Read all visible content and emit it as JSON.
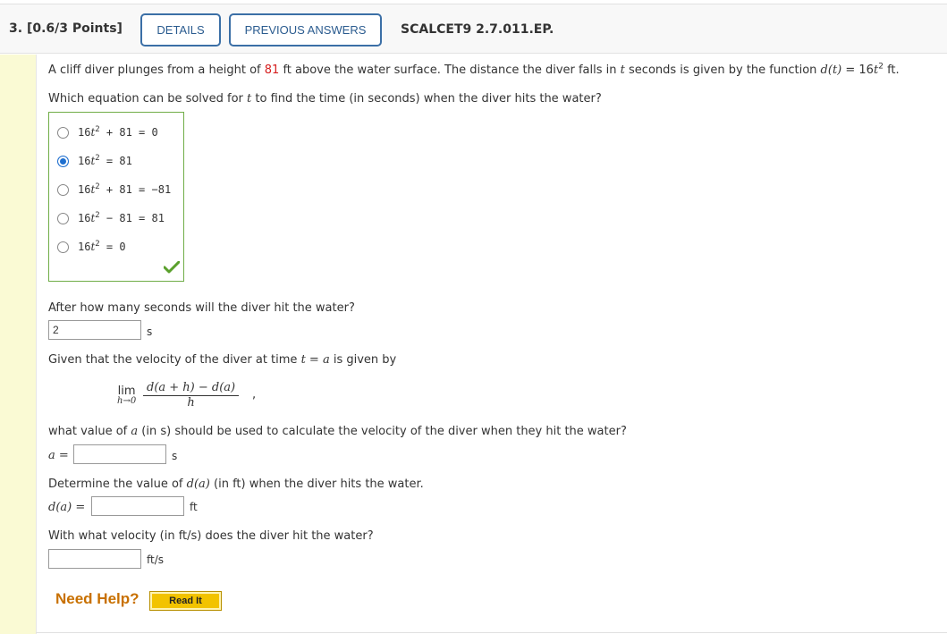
{
  "header": {
    "question_number": "3.",
    "points": "[0.6/3 Points]",
    "details_button": "DETAILS",
    "previous_answers_button": "PREVIOUS ANSWERS",
    "code": "SCALCET9 2.7.011.EP."
  },
  "problem": {
    "intro_part1": "A cliff diver plunges from a height of",
    "height_value": "81",
    "intro_part2": "ft above the water surface. The distance the diver falls in",
    "var_t": "t",
    "intro_part3": "seconds is given by the function",
    "func_lhs": "d(t)",
    "func_rhs_coef": "= 16",
    "func_rhs_var": "t",
    "func_rhs_exp": "2",
    "func_unit": "ft."
  },
  "q1": {
    "prompt_part1": "Which equation can be solved for",
    "prompt_var": "t",
    "prompt_part2": "to find the time (in seconds) when the diver hits the water?",
    "options": [
      {
        "coef": "16",
        "var": "t",
        "exp": "2",
        "rest": " + 81 = 0",
        "selected": false
      },
      {
        "coef": "16",
        "var": "t",
        "exp": "2",
        "rest": " = 81",
        "selected": true
      },
      {
        "coef": "16",
        "var": "t",
        "exp": "2",
        "rest": " + 81 = −81",
        "selected": false
      },
      {
        "coef": "16",
        "var": "t",
        "exp": "2",
        "rest": " − 81 = 81",
        "selected": false
      },
      {
        "coef": "16",
        "var": "t",
        "exp": "2",
        "rest": " = 0",
        "selected": false
      }
    ]
  },
  "q2": {
    "prompt": "After how many seconds will the diver hit the water?",
    "value": "2",
    "unit": "s"
  },
  "q3": {
    "given_part1": "Given that the velocity of the diver at time",
    "given_eq": "t = a",
    "given_part2": "is given by",
    "lim": "lim",
    "lim_sub": "h→0",
    "numerator": "d(a + h) − d(a)",
    "denominator": "h",
    "comma": ",",
    "prompt_part1": "what value of",
    "prompt_var": "a",
    "prompt_part2": "(in s) should be used to calculate the velocity of the diver when they hit the water?",
    "label": "a =",
    "value": "",
    "unit": "s"
  },
  "q4": {
    "prompt_part1": "Determine the value of",
    "prompt_expr": "d(a)",
    "prompt_part2": "(in ft) when the diver hits the water.",
    "label": "d(a) =",
    "value": "",
    "unit": "ft"
  },
  "q5": {
    "prompt": "With what velocity (in ft/s) does the diver hit the water?",
    "value": "",
    "unit": "ft/s"
  },
  "help": {
    "need_help": "Need Help?",
    "read_it": "Read It"
  },
  "colors": {
    "accent_blue": "#2a5b8f",
    "correct_green": "#70ad47",
    "highlight_red": "#d62020",
    "help_orange": "#c87000",
    "read_it_yellow": "#f2c300",
    "gutter_yellow": "#fafad4"
  }
}
